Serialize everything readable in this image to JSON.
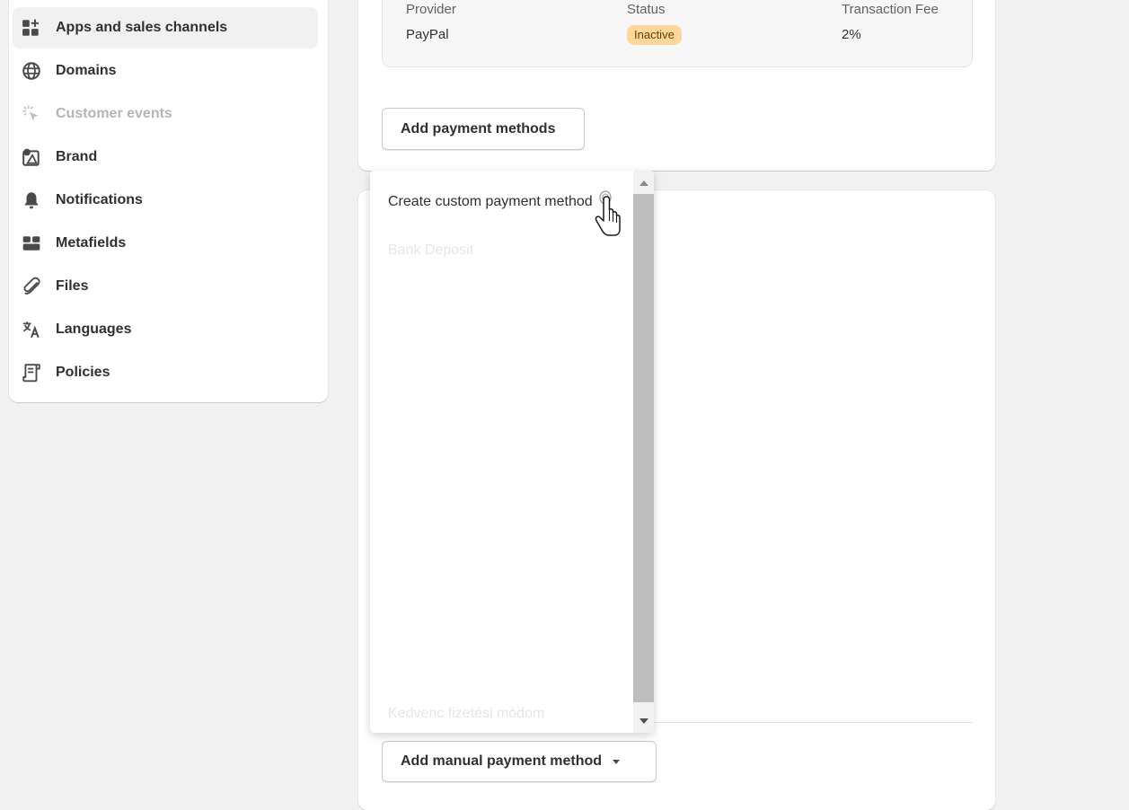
{
  "sidebar": {
    "items": [
      {
        "label": "Apps and sales channels",
        "icon": "apps-plus-icon",
        "active": true,
        "disabled": false
      },
      {
        "label": "Domains",
        "icon": "globe-icon",
        "active": false,
        "disabled": false
      },
      {
        "label": "Customer events",
        "icon": "cursor-click-icon",
        "active": false,
        "disabled": true
      },
      {
        "label": "Brand",
        "icon": "brand-icon",
        "active": false,
        "disabled": false
      },
      {
        "label": "Notifications",
        "icon": "bell-icon",
        "active": false,
        "disabled": false
      },
      {
        "label": "Metafields",
        "icon": "metafields-icon",
        "active": false,
        "disabled": false
      },
      {
        "label": "Files",
        "icon": "paperclip-icon",
        "active": false,
        "disabled": false
      },
      {
        "label": "Languages",
        "icon": "translate-icon",
        "active": false,
        "disabled": false
      },
      {
        "label": "Policies",
        "icon": "policy-document-icon",
        "active": false,
        "disabled": false
      }
    ]
  },
  "payments": {
    "columns": {
      "provider": "Provider",
      "status": "Status",
      "fee": "Transaction Fee"
    },
    "row": {
      "provider": "PayPal",
      "status": "Inactive",
      "fee": "2%"
    },
    "add_payment_methods_label": "Add payment methods"
  },
  "manual": {
    "button_label": "Add manual payment method",
    "dropdown": {
      "items": [
        {
          "label": "Create custom payment method",
          "faded": false
        },
        {
          "label": "Bank Deposit",
          "faded": true
        },
        {
          "label": "Kedvenc fizetési módom",
          "faded": true
        }
      ]
    }
  },
  "colors": {
    "badge_bg": "#ffd79d",
    "badge_text": "#5e4200",
    "page_bg": "#f1f1f1",
    "active_nav_bg": "#f1f1f1"
  }
}
